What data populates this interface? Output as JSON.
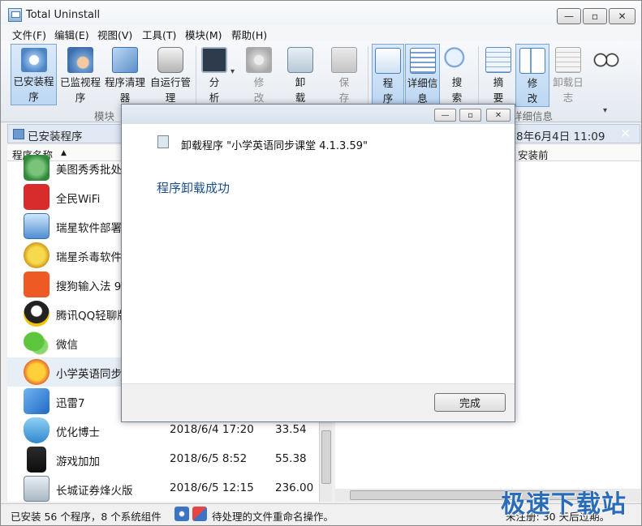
{
  "window": {
    "title": "Total Uninstall"
  },
  "menu": [
    "文件(F)",
    "编辑(E)",
    "视图(V)",
    "工具(T)",
    "模块(M)",
    "帮助(H)"
  ],
  "ribbon": {
    "buttons": [
      {
        "label": "已安装程\n序",
        "active": true
      },
      {
        "label": "已监视程\n序"
      },
      {
        "label": "程序清理\n器"
      },
      {
        "label": "自运行管\n理"
      },
      {
        "label": "分\n析"
      },
      {
        "label": "修\n改",
        "disabled": true
      },
      {
        "label": "卸\n载"
      },
      {
        "label": "保\n存",
        "disabled": true
      },
      {
        "label": "程\n序",
        "active": true
      },
      {
        "label": "详细信\n息",
        "active": true
      },
      {
        "label": "搜\n索"
      },
      {
        "label": "摘\n要"
      },
      {
        "label": "修\n改",
        "active": true
      },
      {
        "label": "卸载日\n志",
        "disabled": true
      }
    ],
    "group_labels": {
      "modules": "模块",
      "details": "详细信息"
    }
  },
  "left_panel": {
    "title": "已安装程序",
    "column": "程序名称"
  },
  "right_panel": {
    "date": "8年6月4日 11:09",
    "column": "安装前"
  },
  "programs": [
    {
      "name": "美图秀秀批处理",
      "date": "",
      "size": ""
    },
    {
      "name": "全民WiFi",
      "date": "",
      "size": ""
    },
    {
      "name": "瑞星软件部署",
      "date": "",
      "size": ""
    },
    {
      "name": "瑞星杀毒软件",
      "date": "",
      "size": ""
    },
    {
      "name": "搜狗输入法 9.",
      "date": "",
      "size": ""
    },
    {
      "name": "腾讯QQ轻聊版",
      "date": "",
      "size": ""
    },
    {
      "name": "微信",
      "date": "",
      "size": ""
    },
    {
      "name": "小学英语同步课",
      "date": "",
      "size": "",
      "selected": true
    },
    {
      "name": "迅雷7",
      "date": "",
      "size": ""
    },
    {
      "name": "优化博士",
      "date": "2018/6/4 17:20",
      "size": "33.54"
    },
    {
      "name": "游戏加加",
      "date": "2018/6/5 8:52",
      "size": "55.38"
    },
    {
      "name": "长城证券烽火版",
      "date": "2018/6/5 12:15",
      "size": "236.00"
    }
  ],
  "status": {
    "left": "已安装 56 个程序，8 个系统组件",
    "middle": "待处理的文件重命名操作。",
    "right": "未注册: 30 天后过期。"
  },
  "watermark": "极速下载站",
  "dialog": {
    "heading": "卸载程序 \"小学英语同步课堂  4.1.3.59\"",
    "message": "程序卸载成功",
    "finish_button": "完成"
  }
}
